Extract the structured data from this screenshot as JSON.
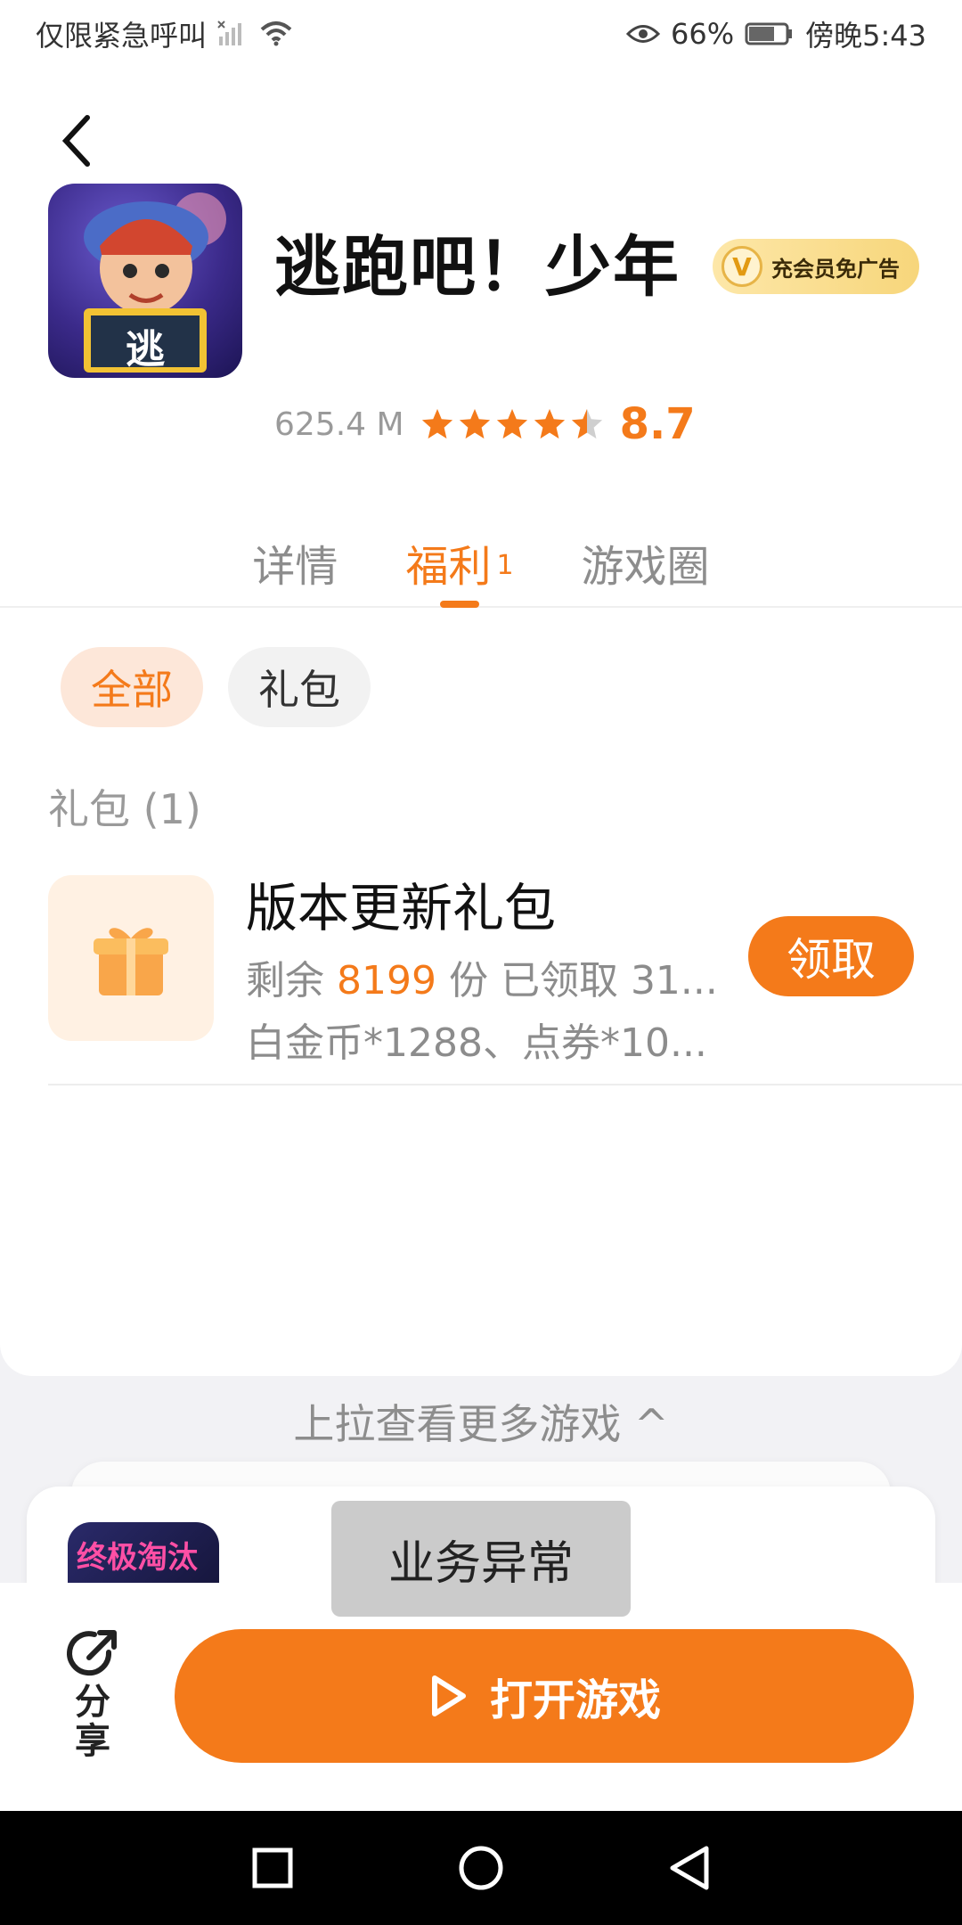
{
  "status_bar": {
    "left_text": "仅限紧急呼叫",
    "battery": "66%",
    "time": "傍晚5:43",
    "icons": [
      "signal-off-icon",
      "wifi-icon",
      "eye-icon",
      "battery-icon"
    ]
  },
  "app": {
    "title": "逃跑吧！少年",
    "icon_char": "逃",
    "vip_badge": "充会员免广告",
    "vip_letter": "V",
    "size": "625.4 M",
    "rating_stars": 4.5,
    "score": "8.7"
  },
  "tabs": [
    {
      "label": "详情"
    },
    {
      "label": "福利",
      "badge": "1"
    },
    {
      "label": "游戏圈"
    }
  ],
  "chips": [
    {
      "label": "全部"
    },
    {
      "label": "礼包"
    }
  ],
  "section_title": "礼包 (1)",
  "gift": {
    "title": "版本更新礼包",
    "remain_prefix": "剩余 ",
    "remain_count": "8199",
    "remain_suffix": " 份 已领取 31...",
    "rewards": "白金币*1288、点券*10...",
    "claim_label": "领取"
  },
  "pullup_text": "上拉查看更多游戏 ^",
  "peek_card": {
    "icon_text": "终极淘汰赛"
  },
  "toast": "业务异常",
  "bottom_bar": {
    "share_label": "分享",
    "open_label": "打开游戏"
  },
  "colors": {
    "accent": "#f47a1a",
    "vip_gold": "#f7d67b"
  }
}
